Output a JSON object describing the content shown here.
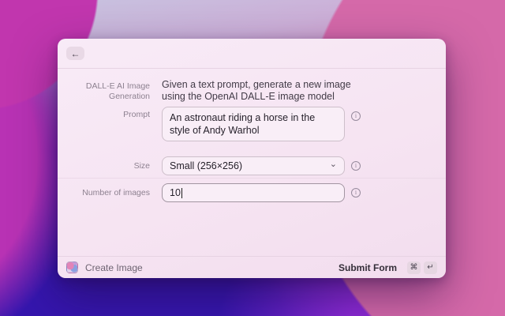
{
  "icons": {
    "back": "←",
    "chevron_down": "⌄",
    "info": "i",
    "key_command": "⌘",
    "key_return": "↵"
  },
  "form": {
    "title": "DALL-E AI Image Generation",
    "description": "Given a text prompt, generate a new image using the OpenAI DALL-E image model",
    "fields": [
      {
        "label": "Prompt",
        "type": "textarea",
        "value": "An astronaut riding a horse in the style of Andy Warhol"
      },
      {
        "label": "Size",
        "type": "dropdown",
        "value": "Small (256×256)"
      },
      {
        "label": "Number of images",
        "type": "text",
        "value": "10"
      }
    ]
  },
  "footer": {
    "action": "Create Image",
    "submit": "Submit Form",
    "keys": [
      "⌘",
      "↵"
    ]
  },
  "colors": {
    "wallpaper_magenta": "#c136ae",
    "wallpaper_pink": "#d569a9",
    "wallpaper_deep_purple": "#3516ae",
    "window_bg": "#f7e8f5",
    "field_border": "#cdbfca"
  }
}
